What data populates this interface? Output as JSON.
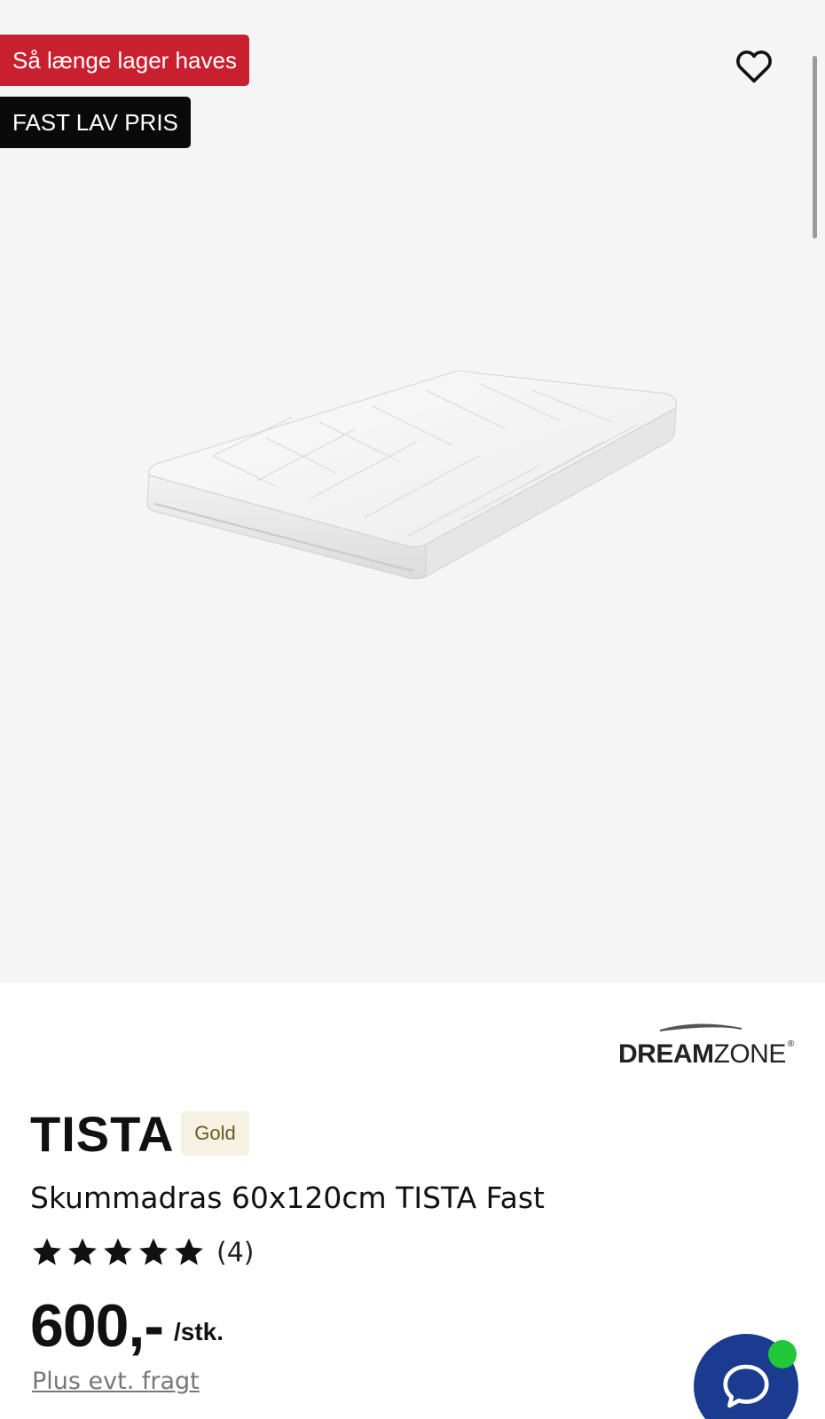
{
  "badges": {
    "stock": "Så længe lager haves",
    "price_tag": "FAST LAV PRIS"
  },
  "colors": {
    "stock_badge": "#c8202f",
    "price_badge": "#0a0a0a",
    "chat_button": "#1a3b8f",
    "online_indicator": "#22c73a",
    "gold_badge_bg": "#f6f1e2"
  },
  "icons": {
    "favorite": "heart-icon",
    "rating": "star-icon",
    "chat": "chat-bubble-icon"
  },
  "brand": {
    "name_bold": "DREAM",
    "name_light": "ZONE",
    "registered": "®"
  },
  "product": {
    "name": "TISTA",
    "tier": "Gold",
    "description": "Skummadras 60x120cm TISTA Fast",
    "rating_stars": 5,
    "rating_count": "(4)",
    "price": "600,-",
    "unit": "/stk.",
    "shipping_note": "Plus evt. fragt"
  }
}
